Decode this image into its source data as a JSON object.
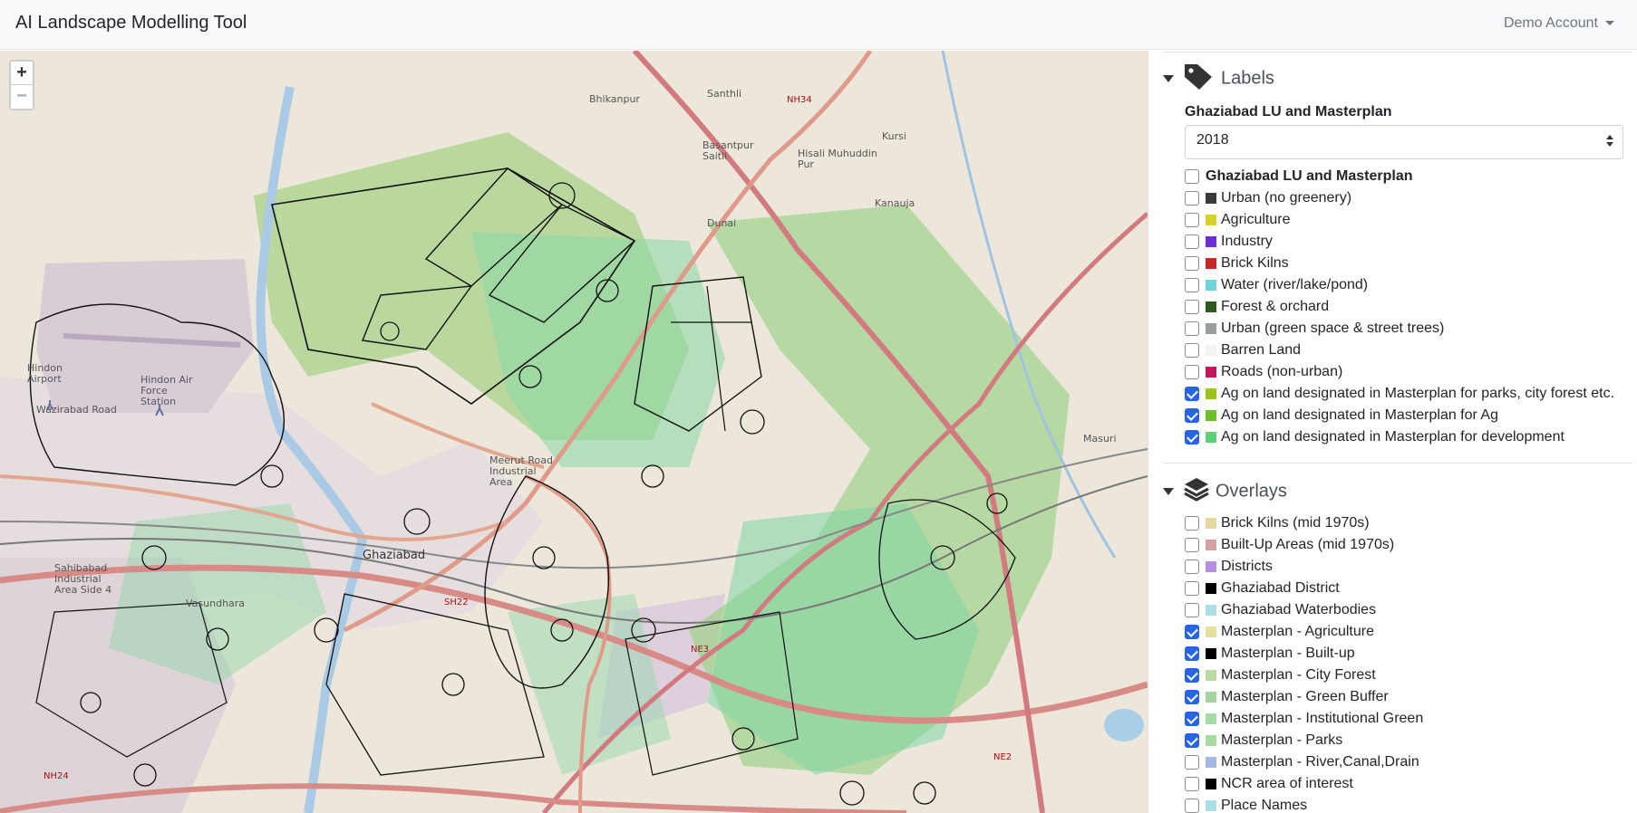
{
  "app": {
    "title": "AI Landscape Modelling Tool",
    "account": "Demo Account"
  },
  "map": {
    "zoom_in": "+",
    "zoom_out": "−",
    "place_labels": [
      "Bhikanpur",
      "Santhli",
      "Basantpur Saitli",
      "Hisali Muhuddin Pur",
      "Kursi",
      "Kanauja",
      "Dunai",
      "Hindon Airport",
      "Hindon Air Force Station",
      "Meerut Road Industrial Area",
      "Ghaziabad",
      "Sahibabad Industrial Area Side 4",
      "Vasundhara",
      "Masuri",
      "Wazirabad Road",
      "NH34",
      "NH24",
      "NE3",
      "NE2",
      "SH22"
    ]
  },
  "labels": {
    "heading": "Labels",
    "group_title": "Ghaziabad LU and Masterplan",
    "year": "2018",
    "items": [
      {
        "label": "Ghaziabad LU and Masterplan",
        "checked": false,
        "color": "",
        "bold": true
      },
      {
        "label": "Urban (no greenery)",
        "checked": false,
        "color": "#3b3b3b"
      },
      {
        "label": "Agriculture",
        "checked": false,
        "color": "#d8d22a"
      },
      {
        "label": "Industry",
        "checked": false,
        "color": "#6a2fd6"
      },
      {
        "label": "Brick Kilns",
        "checked": false,
        "color": "#c62828"
      },
      {
        "label": "Water (river/lake/pond)",
        "checked": false,
        "color": "#6fd6e0"
      },
      {
        "label": "Forest & orchard",
        "checked": false,
        "color": "#2e5a1c"
      },
      {
        "label": "Urban (green space & street trees)",
        "checked": false,
        "color": "#9aa0a0"
      },
      {
        "label": "Barren Land",
        "checked": false,
        "color": "#f4f4f4"
      },
      {
        "label": "Roads (non-urban)",
        "checked": false,
        "color": "#c2185b"
      },
      {
        "label": "Ag on land designated in Masterplan for parks, city forest etc.",
        "checked": true,
        "color": "#9bc41f"
      },
      {
        "label": "Ag on land designated in Masterplan for Ag",
        "checked": true,
        "color": "#6cbf2a"
      },
      {
        "label": "Ag on land designated in Masterplan for development",
        "checked": true,
        "color": "#5fd177"
      }
    ]
  },
  "overlays": {
    "heading": "Overlays",
    "items": [
      {
        "label": "Brick Kilns (mid 1970s)",
        "checked": false,
        "color": "#e6d9a0"
      },
      {
        "label": "Built-Up Areas (mid 1970s)",
        "checked": false,
        "color": "#d9a0a0"
      },
      {
        "label": "Districts",
        "checked": false,
        "color": "#b68fe0"
      },
      {
        "label": "Ghaziabad District",
        "checked": false,
        "color": "#000000"
      },
      {
        "label": "Ghaziabad Waterbodies",
        "checked": false,
        "color": "#a8dfe6"
      },
      {
        "label": "Masterplan - Agriculture",
        "checked": true,
        "color": "#e6e0a0"
      },
      {
        "label": "Masterplan - Built-up",
        "checked": true,
        "color": "#000000"
      },
      {
        "label": "Masterplan - City Forest",
        "checked": true,
        "color": "#b9dca0"
      },
      {
        "label": "Masterplan - Green Buffer",
        "checked": true,
        "color": "#a6d6a0"
      },
      {
        "label": "Masterplan - Institutional Green",
        "checked": true,
        "color": "#a6dca6"
      },
      {
        "label": "Masterplan - Parks",
        "checked": true,
        "color": "#a6dca0"
      },
      {
        "label": "Masterplan - River,Canal,Drain",
        "checked": false,
        "color": "#a6b8e6"
      },
      {
        "label": "NCR area of interest",
        "checked": false,
        "color": "#000000"
      },
      {
        "label": "Place Names",
        "checked": false,
        "color": "#a8dfe6"
      }
    ]
  }
}
